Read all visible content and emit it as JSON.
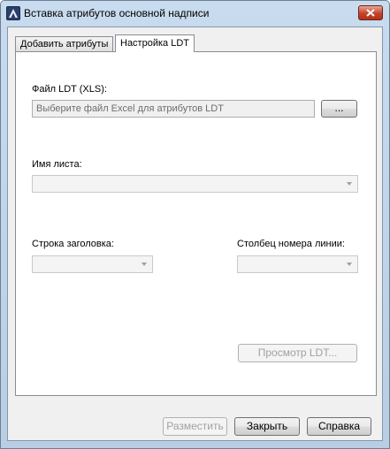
{
  "window": {
    "title": "Вставка атрибутов основной надписи"
  },
  "tabs": [
    {
      "label": "Добавить атрибуты",
      "active": false
    },
    {
      "label": "Настройка LDT",
      "active": true
    }
  ],
  "ldt_file": {
    "label": "Файл LDT (XLS):",
    "placeholder": "Выберите файл Excel для атрибутов LDT",
    "browse_label": "..."
  },
  "sheet": {
    "label": "Имя листа:",
    "value": ""
  },
  "header_row": {
    "label": "Строка заголовка:",
    "value": ""
  },
  "line_column": {
    "label": "Столбец номера линии:",
    "value": ""
  },
  "preview_label": "Просмотр LDT...",
  "footer": {
    "place_label": "Разместить",
    "close_label": "Закрыть",
    "help_label": "Справка"
  },
  "colors": {
    "title_gradient_top": "#c9dbee",
    "close_red": "#c5432a",
    "panel": "#ffffff",
    "dialog": "#f0f0f0"
  },
  "icons": {
    "app": "autocad-app-icon",
    "close": "close-icon",
    "dropdown": "chevron-down-icon"
  }
}
